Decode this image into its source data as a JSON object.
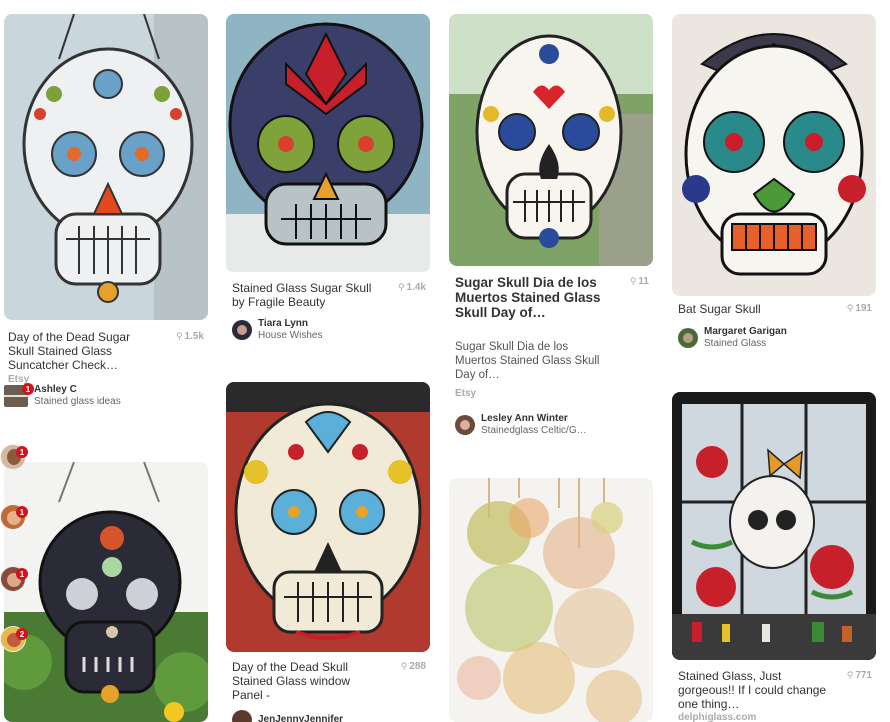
{
  "colors": {
    "save_count_grey": "#aaaaaa",
    "notification_red": "#d0141e",
    "title_text": "#333333"
  },
  "pins": {
    "p1": {
      "title": "Day of the Dead Sugar Skull Stained Glass Suncatcher Check…",
      "saves": "1.5k",
      "source": "Etsy",
      "collaborator_name": "Ashley C",
      "collaborator_board": "Stained glass ideas",
      "notification_count": "1"
    },
    "p2": {
      "title": "Stained Glass Sugar Skull by Fragile Beauty",
      "saves": "1.4k",
      "author_name": "Tiara Lynn",
      "author_board": "House Wishes"
    },
    "p3": {
      "title": "Sugar Skull Dia de los Muertos Stained Glass Skull Day of…",
      "description": "Sugar Skull Dia de los Muertos Stained Glass Skull Day of…",
      "saves": "11",
      "source": "Etsy",
      "author_name": "Lesley Ann Winter",
      "author_board": "Stainedglass Celtic/G…"
    },
    "p4": {
      "title": "Bat Sugar Skull",
      "saves": "191",
      "author_name": "Margaret Garigan",
      "author_board": "Stained Glass"
    },
    "p6": {
      "title": "Day of the Dead Skull Stained Glass window Panel -",
      "saves": "288",
      "author_name": "JenJennyJennifer"
    },
    "p8": {
      "title": "Stained Glass, Just gorgeous!! If I could change one thing…",
      "saves": "771",
      "source": "delphiglass.com"
    }
  },
  "side_avatars": [
    {
      "badge": "1"
    },
    {
      "badge": "1"
    },
    {
      "badge": "1"
    },
    {
      "badge": "2"
    }
  ],
  "icons": {
    "pin_glyph": "⚲"
  }
}
